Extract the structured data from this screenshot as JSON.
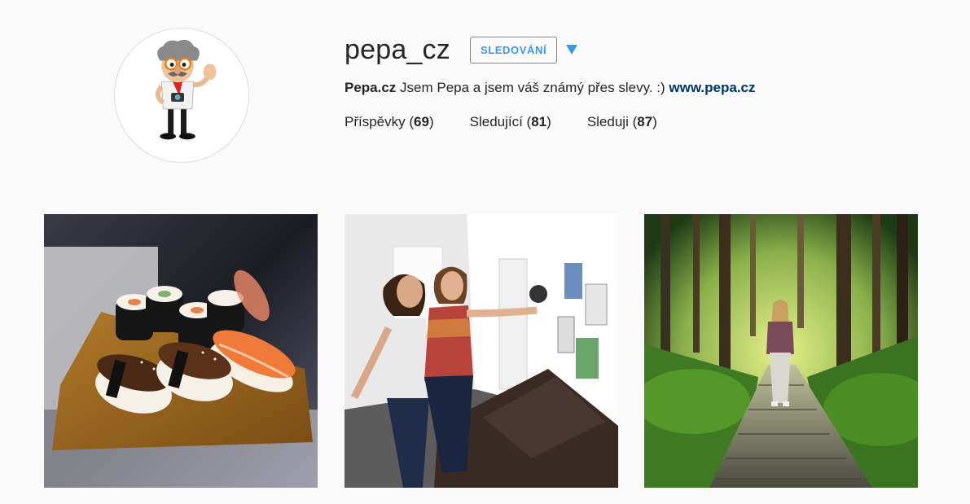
{
  "profile": {
    "username": "pepa_cz",
    "follow_button_label": "SLEDOVÁNÍ",
    "bio_name": "Pepa.cz",
    "bio_text": " Jsem Pepa a jsem váš známý přes slevy. :) ",
    "bio_link": "www.pepa.cz"
  },
  "stats": [
    {
      "label": "Příspěvky",
      "count": "69"
    },
    {
      "label": "Sledující",
      "count": "81"
    },
    {
      "label": "Sleduji",
      "count": "87"
    }
  ],
  "colors": {
    "accent": "#3897f0",
    "link": "#003569",
    "background": "#fafafa"
  },
  "posts": [
    {
      "subject": "sushi platter on wooden board"
    },
    {
      "subject": "two women pointing at posters in office hallway"
    },
    {
      "subject": "woman on wooden boardwalk in forest"
    }
  ]
}
